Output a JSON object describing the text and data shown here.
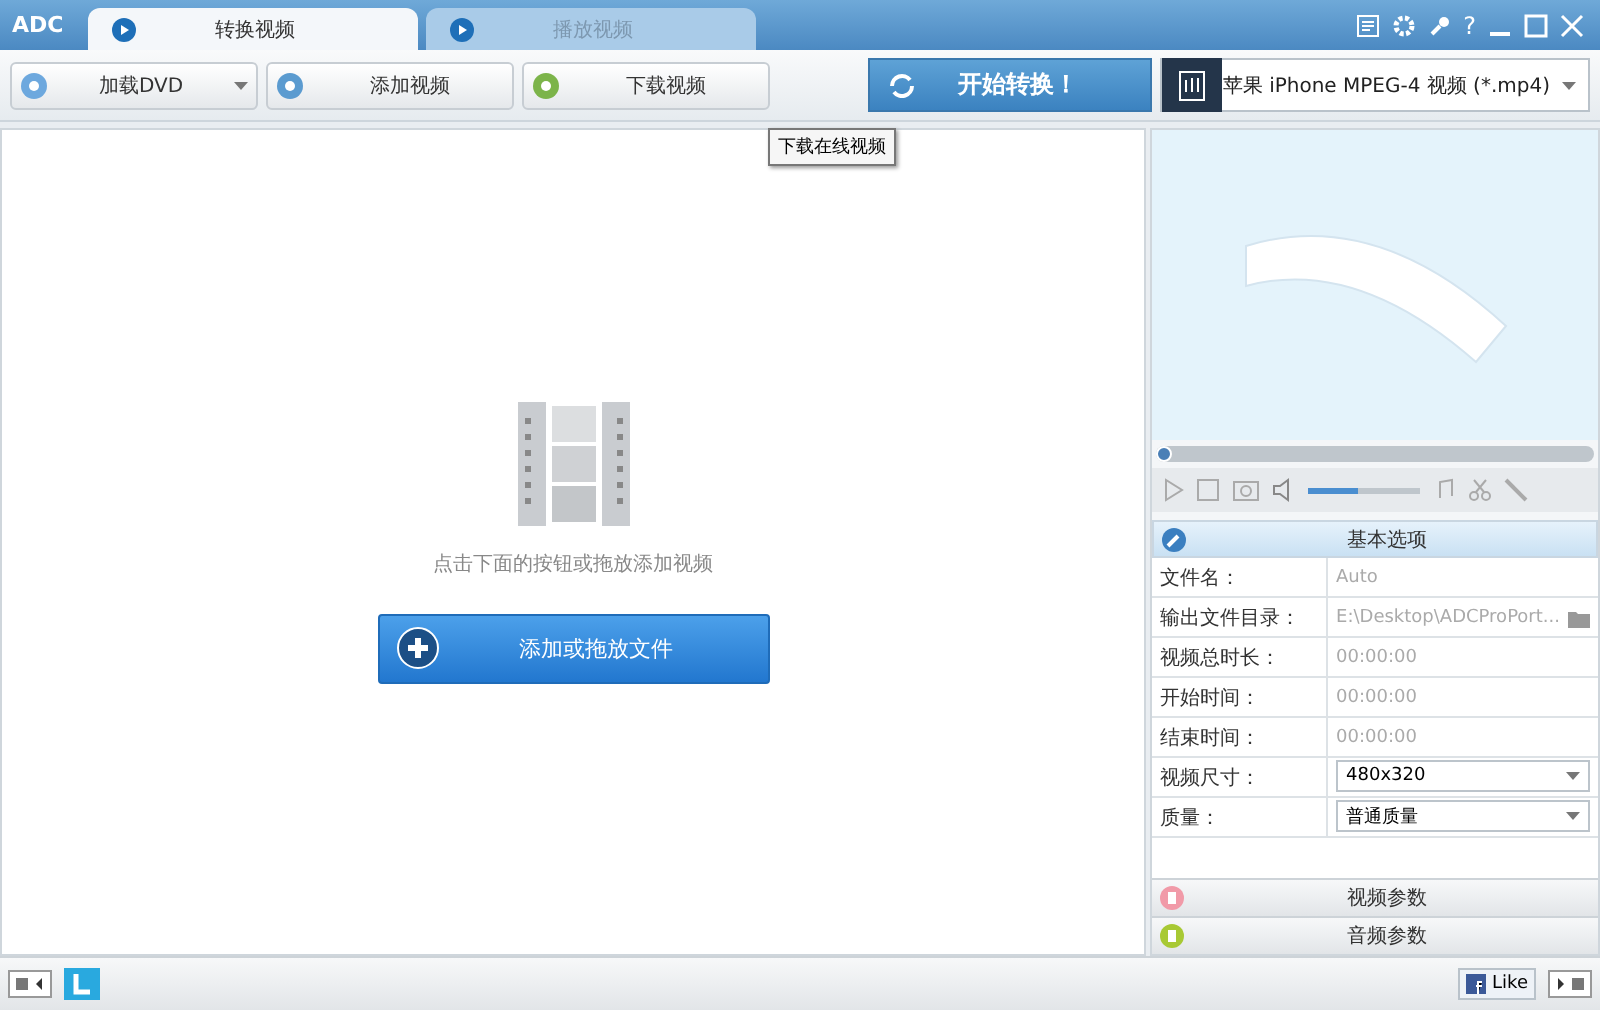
{
  "title_bar": {
    "logo": "ADC",
    "tabs": [
      {
        "label": "转换视频",
        "selected": true
      },
      {
        "label": "播放视频",
        "selected": false
      }
    ],
    "window_buttons": [
      "?"
    ]
  },
  "toolbar": {
    "buttons": [
      {
        "label": "加载DVD",
        "dropdown": true
      },
      {
        "label": "添加视频",
        "dropdown": false
      },
      {
        "label": "下载视频",
        "dropdown": false
      }
    ],
    "start_button": "开始转换！",
    "profile": "苹果 iPhone MPEG-4 视频 (*.mp4)"
  },
  "tooltip": "下载在线视频",
  "empty_state": {
    "hint": "点击下面的按钮或拖放添加视频",
    "add_button": "添加或拖放文件"
  },
  "player": {
    "seek": {
      "level": 0
    },
    "volume": {
      "level": 0.45
    }
  },
  "options": {
    "title": "基本选项",
    "rows": [
      {
        "label": "文件名：",
        "value": "Auto",
        "kind": "text"
      },
      {
        "label": "输出文件目录：",
        "value": "E:\\Desktop\\ADCProPort...",
        "kind": "folder"
      },
      {
        "label": "视频总时长：",
        "value": "00:00:00",
        "kind": "text"
      },
      {
        "label": "开始时间：",
        "value": "00:00:00",
        "kind": "text"
      },
      {
        "label": "结束时间：",
        "value": "00:00:00",
        "kind": "text"
      },
      {
        "label": "视频尺寸：",
        "value": "480x320",
        "kind": "select"
      },
      {
        "label": "质量：",
        "value": "普通质量",
        "kind": "select"
      }
    ]
  },
  "panels": [
    {
      "label": "视频参数",
      "kind": "video"
    },
    {
      "label": "音频参数",
      "kind": "audio"
    }
  ],
  "footer": {
    "like": "Like"
  }
}
